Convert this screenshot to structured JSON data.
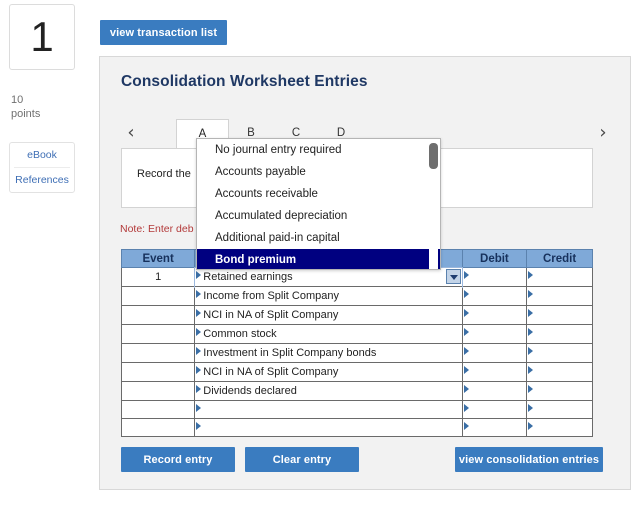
{
  "sidebar": {
    "question_number": "1",
    "points_value": "10",
    "points_label": "points",
    "ebook_label": "eBook",
    "references_label": "References"
  },
  "toolbar": {
    "view_transaction_list_label": "view transaction list"
  },
  "panel": {
    "title": "Consolidation Worksheet Entries",
    "instruction_text": "Record the",
    "note_text": "Note: Enter deb"
  },
  "tabs": {
    "prev_icon": "‹",
    "next_icon": "›",
    "items": [
      {
        "label": "A",
        "active": true
      },
      {
        "label": "B",
        "active": false
      },
      {
        "label": "C",
        "active": false
      },
      {
        "label": "D",
        "active": false
      }
    ]
  },
  "table": {
    "headers": {
      "event": "Event",
      "account": "",
      "debit": "Debit",
      "credit": "Credit"
    },
    "rows": [
      {
        "event": "1",
        "account": "Retained earnings",
        "debit": "",
        "credit": "",
        "active": true
      },
      {
        "event": "",
        "account": "Income from Split Company",
        "debit": "",
        "credit": "",
        "active": false
      },
      {
        "event": "",
        "account": "NCI in NA of Split Company",
        "debit": "",
        "credit": "",
        "active": false
      },
      {
        "event": "",
        "account": "Common stock",
        "debit": "",
        "credit": "",
        "active": false
      },
      {
        "event": "",
        "account": "Investment in Split Company bonds",
        "debit": "",
        "credit": "",
        "active": false
      },
      {
        "event": "",
        "account": "NCI in NA of Split Company",
        "debit": "",
        "credit": "",
        "active": false
      },
      {
        "event": "",
        "account": "Dividends declared",
        "debit": "",
        "credit": "",
        "active": false
      },
      {
        "event": "",
        "account": "",
        "debit": "",
        "credit": "",
        "active": false
      },
      {
        "event": "",
        "account": "",
        "debit": "",
        "credit": "",
        "active": false
      }
    ]
  },
  "dropdown": {
    "open": true,
    "options": [
      {
        "label": "No journal entry required",
        "selected": false
      },
      {
        "label": "Accounts payable",
        "selected": false
      },
      {
        "label": "Accounts receivable",
        "selected": false
      },
      {
        "label": "Accumulated depreciation",
        "selected": false
      },
      {
        "label": "Additional paid-in capital",
        "selected": false
      },
      {
        "label": "Bond premium",
        "selected": true
      }
    ]
  },
  "buttons": {
    "record_entry": "Record entry",
    "clear_entry": "Clear entry",
    "view_consolidation_entries": "view consolidation entries"
  },
  "colors": {
    "accent_blue": "#3a7cc0",
    "header_blue": "#7fa9d8",
    "title_navy": "#1f3864",
    "highlight_navy": "#000080",
    "note_red": "#b33a3a",
    "panel_bg": "#f2f2f2"
  }
}
